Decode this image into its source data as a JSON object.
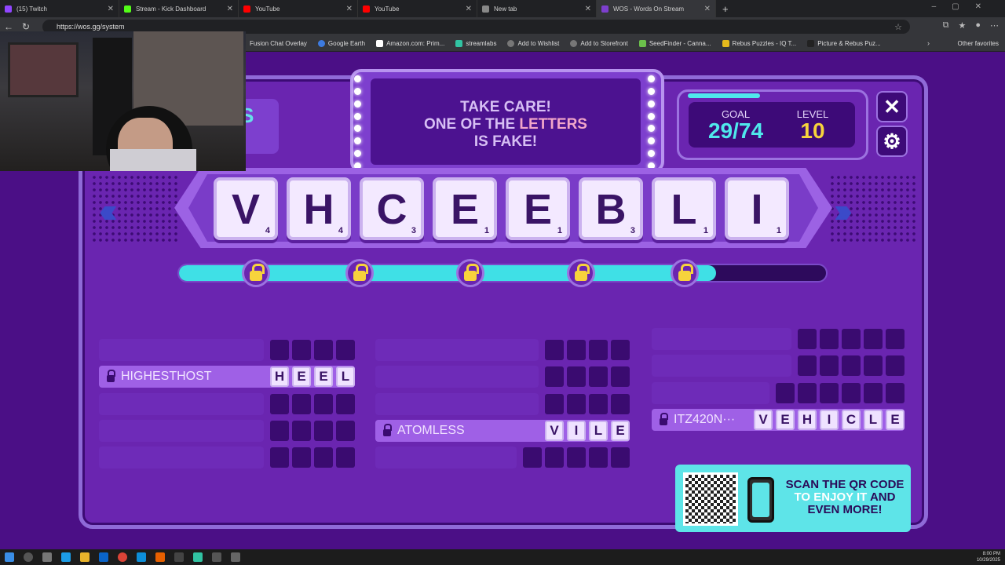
{
  "browser": {
    "tabs": [
      {
        "label": "(15) Twitch",
        "color": "#9146ff"
      },
      {
        "label": "Stream - Kick Dashboard",
        "color": "#53fc18"
      },
      {
        "label": "YouTube",
        "color": "#ff0000"
      },
      {
        "label": "YouTube",
        "color": "#ff0000"
      },
      {
        "label": "New tab",
        "color": "#888888"
      },
      {
        "label": "WOS - Words On Stream",
        "color": "#7d3fce"
      }
    ],
    "url": "https://wos.gg/system",
    "bookmarks": [
      "Fusion Chat Overlay",
      "Google Earth",
      "Amazon.com: Prim...",
      "streamlabs",
      "Add to Wishlist",
      "Add to Storefront",
      "SeedFinder - Canna...",
      "Rebus Puzzles - IQ T...",
      "Picture & Rebus Puz..."
    ],
    "other_favorites": "Other favorites"
  },
  "game": {
    "warning_1": "TAKE CARE!",
    "warning_2a": "ONE OF THE ",
    "warning_2b": "LETTERS",
    "warning_3": "IS FAKE!",
    "logo": "S",
    "goal_label": "GOAL",
    "goal_value": "29/74",
    "level_label": "LEVEL",
    "level_value": "10",
    "close_icon": "✕",
    "settings_icon": "⚙",
    "tiles": [
      {
        "letter": "V",
        "points": "4"
      },
      {
        "letter": "H",
        "points": "4"
      },
      {
        "letter": "C",
        "points": "3"
      },
      {
        "letter": "E",
        "points": "1"
      },
      {
        "letter": "E",
        "points": "1"
      },
      {
        "letter": "B",
        "points": "3"
      },
      {
        "letter": "L",
        "points": "1"
      },
      {
        "letter": "I",
        "points": "1"
      }
    ],
    "progress_fraction": 0.83,
    "col1": [
      {
        "player": "",
        "word": [
          "",
          "",
          "",
          ""
        ]
      },
      {
        "player": "HIGHESTHOST",
        "word": [
          "H",
          "E",
          "E",
          "L"
        ]
      },
      {
        "player": "",
        "word": [
          "",
          "",
          "",
          ""
        ]
      },
      {
        "player": "",
        "word": [
          "",
          "",
          "",
          ""
        ]
      },
      {
        "player": "",
        "word": [
          "",
          "",
          "",
          ""
        ]
      }
    ],
    "col2": [
      {
        "player": "",
        "word": [
          "",
          "",
          "",
          ""
        ]
      },
      {
        "player": "",
        "word": [
          "",
          "",
          "",
          ""
        ]
      },
      {
        "player": "",
        "word": [
          "",
          "",
          "",
          ""
        ]
      },
      {
        "player": "ATOMLESS",
        "word": [
          "V",
          "I",
          "L",
          "E"
        ]
      },
      {
        "player": "",
        "word": [
          "",
          "",
          "",
          "",
          ""
        ]
      }
    ],
    "col3": [
      {
        "player": "",
        "word": [
          "",
          "",
          "",
          "",
          ""
        ]
      },
      {
        "player": "",
        "word": [
          "",
          "",
          "",
          "",
          ""
        ]
      },
      {
        "player": "",
        "word": [
          "",
          "",
          "",
          "",
          "",
          ""
        ]
      },
      {
        "player": "ITZ420N···",
        "word": [
          "V",
          "E",
          "H",
          "I",
          "C",
          "L",
          "E"
        ]
      }
    ],
    "qr_text_a": "SCAN THE QR CODE ",
    "qr_text_b": "TO ENJOY IT",
    "qr_text_c": " AND EVEN MORE!"
  },
  "taskbar": {
    "time": "8:00 PM",
    "date": "10/29/2025"
  }
}
